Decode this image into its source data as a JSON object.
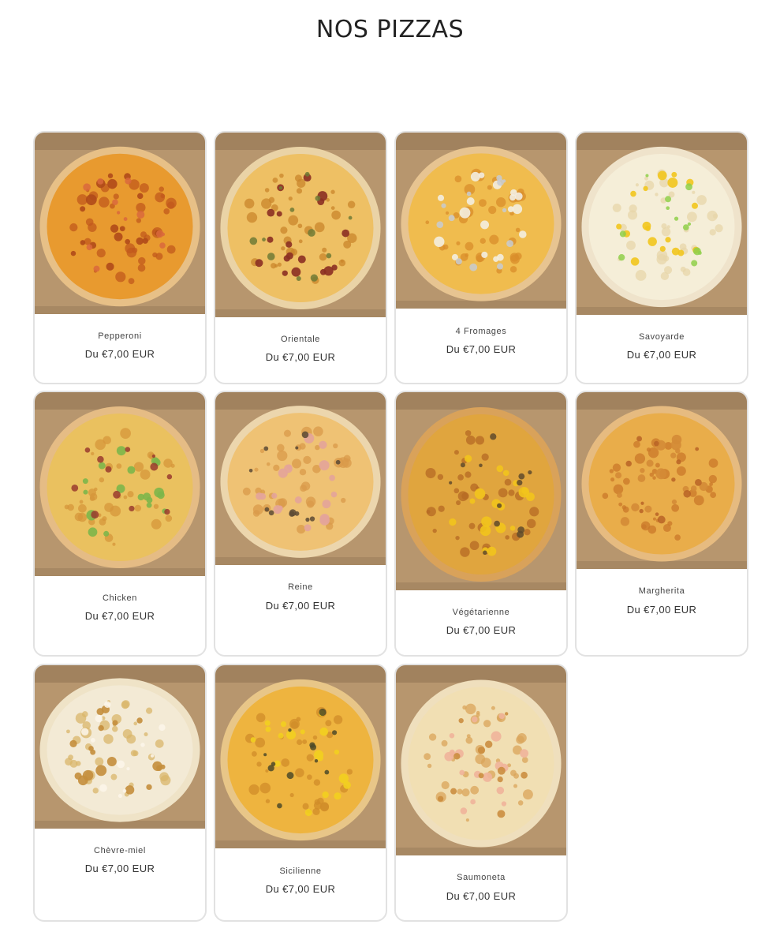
{
  "page": {
    "title": "NOS PIZZAS"
  },
  "price_prefix": "Du",
  "products": [
    {
      "name": "Pepperoni",
      "price": "Du €7,00 EUR",
      "crust": "#e7c087",
      "cheese": "#e89a2f",
      "spot": "#c2581c",
      "topping": "#b04a1a",
      "topping2": "#d9683c"
    },
    {
      "name": "Orientale",
      "price": "Du €7,00 EUR",
      "crust": "#ead3a6",
      "cheese": "#eec064",
      "spot": "#c9862b",
      "topping": "#8b2f22",
      "topping2": "#6e7a35"
    },
    {
      "name": "4 Fromages",
      "price": "Du €7,00 EUR",
      "crust": "#e7c491",
      "cheese": "#f0bc4e",
      "spot": "#d98d2b",
      "topping": "#f3ede0",
      "topping2": "#c7cbd2"
    },
    {
      "name": "Savoyarde",
      "price": "Du €7,00 EUR",
      "crust": "#efe3cb",
      "cheese": "#f5eed8",
      "spot": "#e7d6a9",
      "topping": "#f2c51e",
      "topping2": "#8fcf4a"
    },
    {
      "name": "Chicken",
      "price": "Du €7,00 EUR",
      "crust": "#e5bc85",
      "cheese": "#eac15f",
      "spot": "#d6953a",
      "topping": "#7db64a",
      "topping2": "#9a3b2e"
    },
    {
      "name": "Reine",
      "price": "Du €7,00 EUR",
      "crust": "#ecd6ad",
      "cheese": "#efc274",
      "spot": "#d99a4a",
      "topping": "#e3a49a",
      "topping2": "#5c4a35"
    },
    {
      "name": "Végétarienne",
      "price": "Du €7,00 EUR",
      "crust": "#d9a25a",
      "cheese": "#e0a53e",
      "spot": "#b56a24",
      "topping": "#f2c41c",
      "topping2": "#5f4a2b"
    },
    {
      "name": "Margherita",
      "price": "Du €7,00 EUR",
      "crust": "#e6bb80",
      "cheese": "#e9ad4a",
      "spot": "#c9782a",
      "topping": "#d48b36",
      "topping2": "#b96326"
    },
    {
      "name": "Chèvre-miel",
      "price": "Du €7,00 EUR",
      "crust": "#efe3c7",
      "cheese": "#f3ead5",
      "spot": "#d9b66a",
      "topping": "#c48e3c",
      "topping2": "#fbf6ea"
    },
    {
      "name": "Sicilienne",
      "price": "Du €7,00 EUR",
      "crust": "#e8c688",
      "cheese": "#eeb43f",
      "spot": "#d08c2a",
      "topping": "#f2cf1f",
      "topping2": "#4e4a28"
    },
    {
      "name": "Saumoneta",
      "price": "Du €7,00 EUR",
      "crust": "#efdfbd",
      "cheese": "#f1dfb3",
      "spot": "#d9a45a",
      "topping": "#f0b49a",
      "topping2": "#c98a3a"
    }
  ],
  "colors": {
    "box": "#b7966e",
    "box_dark": "#8f7352",
    "card_border": "#e2e2e2"
  }
}
